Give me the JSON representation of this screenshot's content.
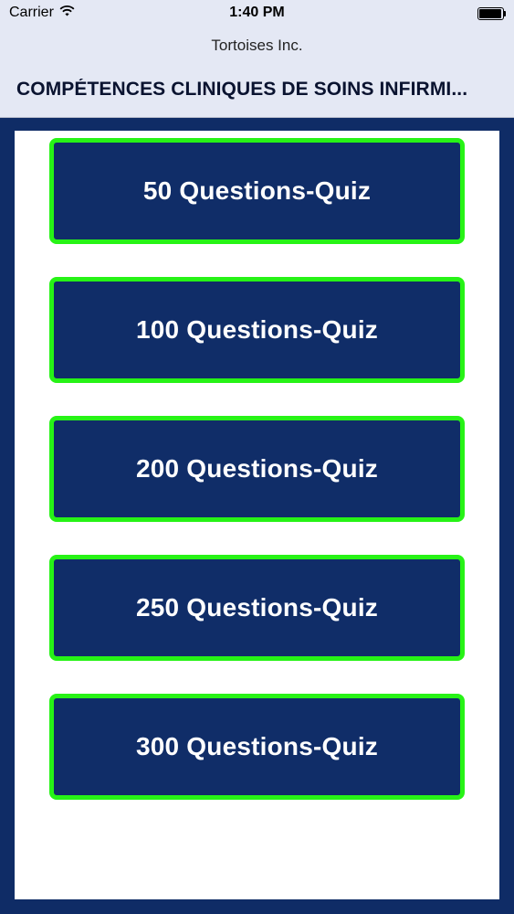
{
  "status_bar": {
    "carrier": "Carrier",
    "time": "1:40 PM",
    "wifi_icon": "wifi-icon",
    "battery_icon": "battery-full-icon"
  },
  "nav": {
    "subtitle": "Tortoises Inc.",
    "title": "COMPÉTENCES CLINIQUES DE SOINS INFIRMI..."
  },
  "colors": {
    "background": "#0f2c66",
    "header": "#e4e8f4",
    "button_fill": "#102d68",
    "button_border": "#27f316",
    "panel": "#ffffff"
  },
  "quiz_buttons": [
    {
      "label": "50 Questions-Quiz"
    },
    {
      "label": "100 Questions-Quiz"
    },
    {
      "label": "200 Questions-Quiz"
    },
    {
      "label": "250 Questions-Quiz"
    },
    {
      "label": "300 Questions-Quiz"
    }
  ]
}
